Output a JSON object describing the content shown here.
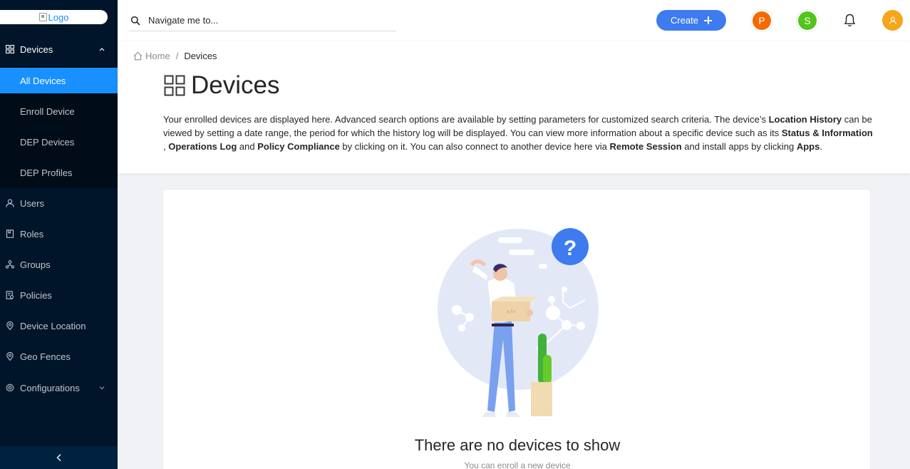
{
  "sidebar": {
    "logo_alt": "Logo",
    "devices": {
      "label": "Devices",
      "icon": "devices-icon",
      "children": [
        {
          "label": "All Devices",
          "active": true
        },
        {
          "label": "Enroll Device"
        },
        {
          "label": "DEP Devices"
        },
        {
          "label": "DEP Profiles"
        }
      ]
    },
    "items": [
      {
        "label": "Users",
        "icon": "user-icon"
      },
      {
        "label": "Roles",
        "icon": "book-icon"
      },
      {
        "label": "Groups",
        "icon": "cluster-icon"
      },
      {
        "label": "Policies",
        "icon": "audit-icon"
      },
      {
        "label": "Device Location",
        "icon": "location-pin-icon"
      },
      {
        "label": "Geo Fences",
        "icon": "location-pin-icon"
      },
      {
        "label": "Configurations",
        "icon": "gear-icon"
      }
    ],
    "collapse_icon": "chevron-left-icon"
  },
  "header": {
    "search_placeholder": "Navigate me to...",
    "create_label": "Create",
    "avatars": [
      {
        "letter": "P",
        "color": "#f56a00"
      },
      {
        "letter": "S",
        "color": "#52c41a"
      }
    ],
    "notification_icon": "bell-icon",
    "user_avatar_color": "#f7a51c"
  },
  "breadcrumb": {
    "home": "Home",
    "separator": "/",
    "current": "Devices"
  },
  "page": {
    "title": "Devices",
    "description_parts": [
      "Your enrolled devices are displayed here. Advanced search options are available by setting parameters for customized search criteria. The device’s ",
      "Location History",
      " can be viewed by setting a date range, the period for which the history log will be displayed. You can view more information about a specific device such as its ",
      "Status & Information",
      " , ",
      "Operations Log",
      " and ",
      "Policy Compliance",
      " by clicking on it. You can also connect to another device here via ",
      "Remote Session",
      " and install apps by clicking ",
      "Apps",
      "."
    ]
  },
  "empty": {
    "title": "There are no devices to show",
    "subtitle": "You can enroll a new device"
  },
  "colors": {
    "sidebar_bg": "#001529",
    "accent": "#1890ff",
    "create_button": "#3d7bef"
  }
}
